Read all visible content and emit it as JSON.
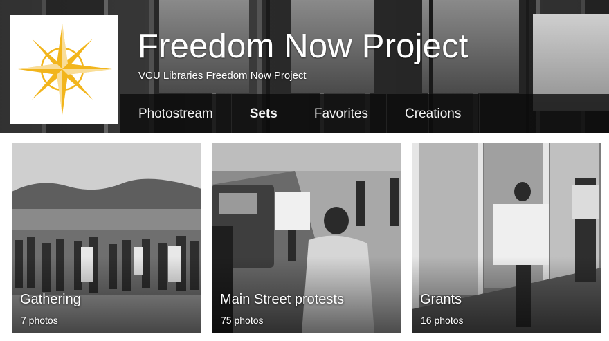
{
  "header": {
    "title": "Freedom Now Project",
    "subtitle": "VCU Libraries Freedom Now Project",
    "logo_icon": "compass-rose-icon",
    "logo_color": "#F2B51C"
  },
  "tabs": [
    {
      "label": "Photostream",
      "active": false
    },
    {
      "label": "Sets",
      "active": true
    },
    {
      "label": "Favorites",
      "active": false
    },
    {
      "label": "Creations",
      "active": false
    }
  ],
  "sets": [
    {
      "title": "Gathering",
      "count": "7 photos"
    },
    {
      "title": "Main Street protests",
      "count": "75 photos"
    },
    {
      "title": "Grants",
      "count": "16 photos"
    }
  ]
}
